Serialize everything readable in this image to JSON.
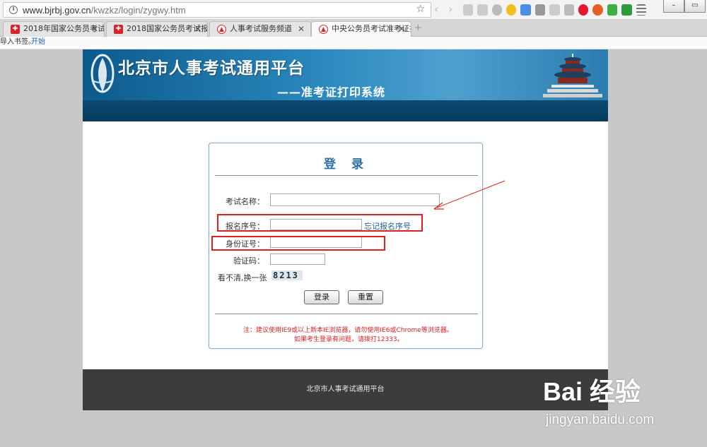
{
  "browser": {
    "url_host": "www.bjrbj.gov.cn",
    "url_path": "/kwzkz/login/zygwy.htm",
    "tabs": [
      {
        "label": "2018年国家公务员考试"
      },
      {
        "label": "2018国家公务员考试报"
      },
      {
        "label": "人事考试服务频道"
      },
      {
        "label": "中央公务员考试准考证打"
      }
    ],
    "bookmarks": {
      "import_text": "导入书签。",
      "start_link": "开始"
    }
  },
  "site": {
    "title": "北京市人事考试通用平台",
    "subtitle": "——准考证打印系统"
  },
  "login": {
    "title": "登 录",
    "exam_name_label": "考试名称：",
    "exam_name_value": "",
    "reg_no_label": "报名序号：",
    "reg_no_value": "",
    "forgot_reg_no": "忘记报名序号",
    "id_label": "身份证号：",
    "id_value": "",
    "captcha_label": "验证码：",
    "captcha_value": "",
    "refresh_label": "看不清,换一张",
    "captcha_text": "8213",
    "login_button": "登录",
    "reset_button": "重置",
    "note_line1": "注：建议使用IE9或以上新本IE浏览器，请勿使用IE6或Chrome等浏览器。",
    "note_line2": "如果考生登录有问题，请拨打12333。"
  },
  "footer": {
    "text": "北京市人事考试通用平台"
  },
  "watermark": {
    "main": "Bai 经验",
    "url": "jingyan.baidu.com"
  },
  "colors": {
    "accent": "#2a70a8",
    "annotation": "#e02020",
    "banner": "#1e78b0"
  }
}
